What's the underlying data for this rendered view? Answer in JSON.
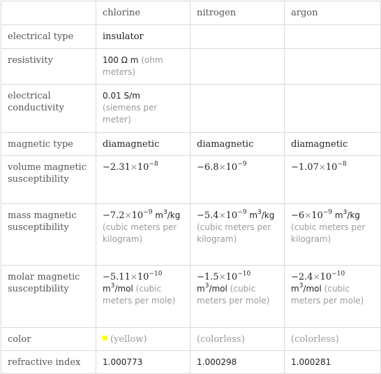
{
  "columns": [
    "",
    "chlorine",
    "nitrogen",
    "argon"
  ],
  "rows": {
    "electrical_type": {
      "label": "electrical type",
      "values": [
        "insulator",
        "",
        ""
      ]
    },
    "resistivity": {
      "label": "resistivity",
      "chlorine": {
        "value": "100",
        "unit": "Ω m",
        "desc": "(ohm meters)"
      }
    },
    "electrical_conductivity": {
      "label": "electrical conductivity",
      "chlorine": {
        "value": "0.01",
        "unit": "S/m",
        "desc": "(siemens per meter)"
      }
    },
    "magnetic_type": {
      "label": "magnetic type",
      "values": [
        "diamagnetic",
        "diamagnetic",
        "diamagnetic"
      ]
    },
    "volume_magnetic_susceptibility": {
      "label": "volume magnetic susceptibility",
      "values": [
        {
          "mantissa": "−2.31",
          "exponent": "−8"
        },
        {
          "mantissa": "−6.8",
          "exponent": "−9"
        },
        {
          "mantissa": "−1.07",
          "exponent": "−8"
        }
      ]
    },
    "mass_magnetic_susceptibility": {
      "label": "mass magnetic susceptibility",
      "values": [
        {
          "mantissa": "−7.2",
          "exponent": "−9",
          "unit_a": "m",
          "unit_pow": "3",
          "unit_b": "/kg",
          "desc": "(cubic meters per kilogram)"
        },
        {
          "mantissa": "−5.4",
          "exponent": "−9",
          "unit_a": "m",
          "unit_pow": "3",
          "unit_b": "/kg",
          "desc": "(cubic meters per kilogram)"
        },
        {
          "mantissa": "−6",
          "exponent": "−9",
          "unit_a": "m",
          "unit_pow": "3",
          "unit_b": "/kg",
          "desc": "(cubic meters per kilogram)"
        }
      ]
    },
    "molar_magnetic_susceptibility": {
      "label": "molar magnetic susceptibility",
      "values": [
        {
          "mantissa": "−5.11",
          "exponent": "−10",
          "unit_a": "m",
          "unit_pow": "3",
          "unit_b": "/mol",
          "desc": "(cubic meters per mole)"
        },
        {
          "mantissa": "−1.5",
          "exponent": "−10",
          "unit_a": "m",
          "unit_pow": "3",
          "unit_b": "/mol",
          "desc": "(cubic meters per mole)"
        },
        {
          "mantissa": "−2.4",
          "exponent": "−10",
          "unit_a": "m",
          "unit_pow": "3",
          "unit_b": "/mol",
          "desc": "(cubic meters per mole)"
        }
      ]
    },
    "color": {
      "label": "color",
      "values": [
        {
          "text": "(yellow)",
          "swatch": "#ffff00"
        },
        {
          "text": "(colorless)"
        },
        {
          "text": "(colorless)"
        }
      ]
    },
    "refractive_index": {
      "label": "refractive index",
      "values": [
        "1.000773",
        "1.000298",
        "1.000281"
      ]
    }
  },
  "symbols": {
    "times": "×",
    "base": "10"
  }
}
